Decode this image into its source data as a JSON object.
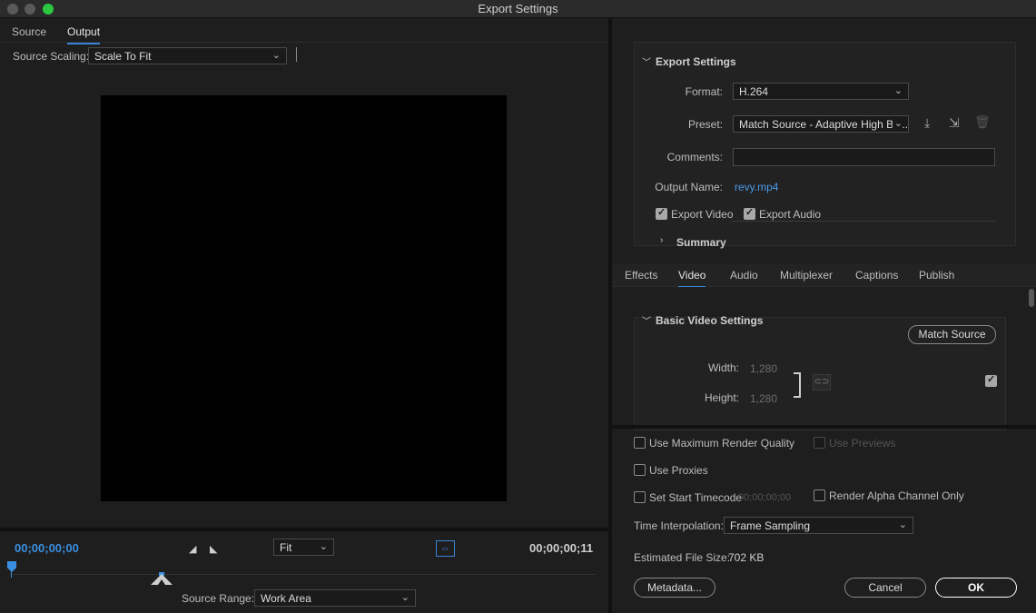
{
  "window": {
    "title": "Export Settings"
  },
  "left": {
    "tabs": [
      {
        "label": "Source"
      },
      {
        "label": "Output"
      }
    ],
    "source_scaling_label": "Source Scaling:",
    "source_scaling_value": "Scale To Fit",
    "timecode_in": "00;00;00;00",
    "timecode_out": "00;00;00;11",
    "zoom_value": "Fit",
    "source_range_label": "Source Range:",
    "source_range_value": "Work Area"
  },
  "export_settings": {
    "section_title": "Export Settings",
    "format_label": "Format:",
    "format_value": "H.264",
    "preset_label": "Preset:",
    "preset_value": "Match Source - Adaptive High Bit...",
    "comments_label": "Comments:",
    "comments_value": "",
    "output_name_label": "Output Name:",
    "output_name_value": "revy.mp4",
    "export_video_label": "Export Video",
    "export_audio_label": "Export Audio",
    "summary_label": "Summary"
  },
  "tabs_right": [
    {
      "label": "Effects"
    },
    {
      "label": "Video"
    },
    {
      "label": "Audio"
    },
    {
      "label": "Multiplexer"
    },
    {
      "label": "Captions"
    },
    {
      "label": "Publish"
    }
  ],
  "basic_video": {
    "section_title": "Basic Video Settings",
    "match_source_label": "Match Source",
    "width_label": "Width:",
    "width_value": "1,280",
    "height_label": "Height:",
    "height_value": "1,280"
  },
  "bottom": {
    "max_render_label": "Use Maximum Render Quality",
    "use_previews_label": "Use Previews",
    "use_proxies_label": "Use Proxies",
    "set_start_tc_label": "Set Start Timecode",
    "start_tc_value": "00;00;00;00",
    "render_alpha_label": "Render Alpha Channel Only",
    "time_interp_label": "Time Interpolation:",
    "time_interp_value": "Frame Sampling",
    "est_size_label": "Estimated File Size:",
    "est_size_value": "702 KB",
    "metadata_label": "Metadata...",
    "cancel_label": "Cancel",
    "ok_label": "OK"
  },
  "icons": {
    "save_preset": "download-icon",
    "import_preset": "import-icon",
    "delete_preset": "trash-icon",
    "link": "link-icon"
  },
  "colors": {
    "accent": "#3a8fe0",
    "link": "#4a9ae8",
    "maximize": "#2bc840"
  }
}
